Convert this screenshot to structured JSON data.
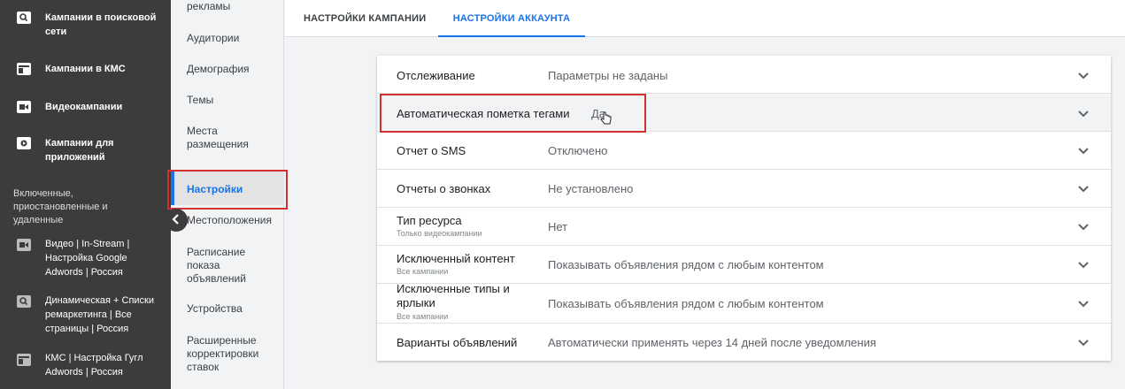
{
  "left_nav": {
    "items": [
      {
        "label": "Кампании в поисковой сети",
        "icon": "search-icon"
      },
      {
        "label": "Кампании в КМС",
        "icon": "display-icon"
      },
      {
        "label": "Видеокампании",
        "icon": "video-icon"
      },
      {
        "label": "Кампании для приложений",
        "icon": "app-icon"
      }
    ],
    "section_label": "Включенные, приостановленные и удаленные",
    "campaigns": [
      {
        "label": "Видео | In-Stream | Настройка Google Adwords | Россия",
        "icon": "video-icon"
      },
      {
        "label": "Динамическая + Списки ремаркетинга | Все страницы | Россия",
        "icon": "search-icon"
      },
      {
        "label": "КМС | Настройка Гугл Adwords | Россия",
        "icon": "display-icon"
      }
    ]
  },
  "page_nav": {
    "items": [
      {
        "label": "рекламы"
      },
      {
        "label": "Аудитории"
      },
      {
        "label": "Демография"
      },
      {
        "label": "Темы"
      },
      {
        "label": "Места размещения"
      },
      {
        "label": "Настройки"
      },
      {
        "label": "Местоположения"
      },
      {
        "label": "Расписание показа объявлений"
      },
      {
        "label": "Устройства"
      },
      {
        "label": "Расширенные корректировки ставок"
      }
    ],
    "active_index": 5
  },
  "tabs": [
    {
      "label": "НАСТРОЙКИ КАМПАНИИ"
    },
    {
      "label": "НАСТРОЙКИ АККАУНТА"
    }
  ],
  "settings": [
    {
      "label": "Отслеживание",
      "sub": "",
      "value": "Параметры не заданы"
    },
    {
      "label": "Автоматическая пометка тегами",
      "sub": "",
      "value": "Да"
    },
    {
      "label": "Отчет о SMS",
      "sub": "",
      "value": "Отключено"
    },
    {
      "label": "Отчеты о звонках",
      "sub": "",
      "value": "Не установлено"
    },
    {
      "label": "Тип ресурса",
      "sub": "Только видеокампании",
      "value": "Нет"
    },
    {
      "label": "Исключенный контент",
      "sub": "Все кампании",
      "value": "Показывать объявления рядом с любым контентом"
    },
    {
      "label": "Исключенные типы и ярлыки",
      "sub": "Все кампании",
      "value": "Показывать объявления рядом с любым контентом"
    },
    {
      "label": "Варианты объявлений",
      "sub": "",
      "value": "Автоматически применять через 14 дней после уведомления"
    }
  ],
  "colors": {
    "accent": "#1a73e8",
    "highlight_box": "#d32f2f",
    "sidebar": "#3c3c3c"
  }
}
